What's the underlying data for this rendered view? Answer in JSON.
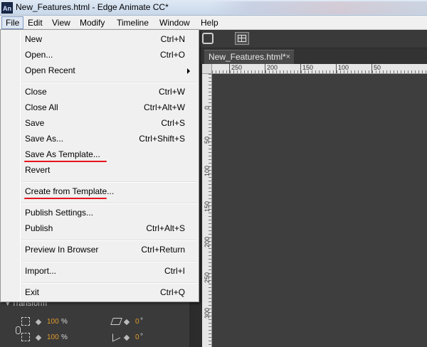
{
  "window": {
    "app_icon_text": "An",
    "title": "New_Features.html - Edge Animate CC*"
  },
  "menubar": {
    "items": [
      "File",
      "Edit",
      "View",
      "Modify",
      "Timeline",
      "Window",
      "Help"
    ],
    "active": "File"
  },
  "file_menu": {
    "items": [
      {
        "label": "New",
        "shortcut": "Ctrl+N"
      },
      {
        "label": "Open...",
        "shortcut": "Ctrl+O"
      },
      {
        "label": "Open Recent",
        "shortcut": "",
        "submenu": true
      },
      {
        "label": "Close",
        "shortcut": "Ctrl+W"
      },
      {
        "label": "Close All",
        "shortcut": "Ctrl+Alt+W"
      },
      {
        "label": "Save",
        "shortcut": "Ctrl+S"
      },
      {
        "label": "Save As...",
        "shortcut": "Ctrl+Shift+S"
      },
      {
        "label": "Save As Template...",
        "shortcut": "",
        "highlighted": true
      },
      {
        "label": "Revert",
        "shortcut": ""
      },
      {
        "label": "Create from Template...",
        "shortcut": "",
        "highlighted": true
      },
      {
        "label": "Publish Settings...",
        "shortcut": ""
      },
      {
        "label": "Publish",
        "shortcut": "Ctrl+Alt+S"
      },
      {
        "label": "Preview In Browser",
        "shortcut": "Ctrl+Return"
      },
      {
        "label": "Import...",
        "shortcut": "Ctrl+I"
      },
      {
        "label": "Exit",
        "shortcut": "Ctrl+Q"
      }
    ],
    "highlight_color": "#e8121b"
  },
  "document_tab": {
    "label": "New_Features.html*",
    "close": "×"
  },
  "ruler": {
    "horizontal_labels": [
      "250",
      "200",
      "150",
      "100",
      "50"
    ],
    "vertical_labels": [
      "0",
      "50",
      "100",
      "150",
      "200",
      "250",
      "300"
    ]
  },
  "transform_panel": {
    "header": "Transform",
    "scale_x": "100",
    "scale_y": "100",
    "unit_percent": "%",
    "skew": "0",
    "rotate": "0",
    "unit_degree": "°"
  },
  "colors": {
    "stage_bg": "#3e3e3e",
    "menu_bg": "#f0f0f0",
    "value_orange": "#e09a2a"
  }
}
